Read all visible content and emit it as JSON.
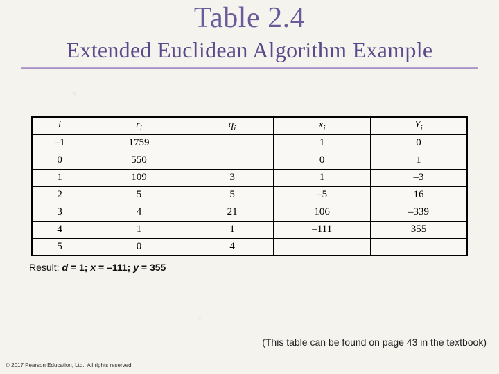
{
  "title": "Table 2.4",
  "subtitle": "Extended Euclidean Algorithm Example",
  "chart_data": {
    "type": "table",
    "headers": [
      {
        "sym": "i",
        "sub": ""
      },
      {
        "sym": "r",
        "sub": "i"
      },
      {
        "sym": "q",
        "sub": "i"
      },
      {
        "sym": "x",
        "sub": "i"
      },
      {
        "sym": "Y",
        "sub": "i"
      }
    ],
    "rows": [
      {
        "i": "–1",
        "r": "1759",
        "q": "",
        "x": "1",
        "y": "0"
      },
      {
        "i": "0",
        "r": "550",
        "q": "",
        "x": "0",
        "y": "1"
      },
      {
        "i": "1",
        "r": "109",
        "q": "3",
        "x": "1",
        "y": "–3"
      },
      {
        "i": "2",
        "r": "5",
        "q": "5",
        "x": "–5",
        "y": "16"
      },
      {
        "i": "3",
        "r": "4",
        "q": "21",
        "x": "106",
        "y": "–339"
      },
      {
        "i": "4",
        "r": "1",
        "q": "1",
        "x": "–111",
        "y": "355"
      },
      {
        "i": "5",
        "r": "0",
        "q": "4",
        "x": "",
        "y": ""
      }
    ]
  },
  "result": {
    "prefix": "Result: ",
    "d_var": "d",
    "d_val": " = 1; ",
    "x_var": "x",
    "x_val": " = –111; ",
    "y_var": "y",
    "y_val": " = 355"
  },
  "caption": "(This table can be found on page 43 in the textbook)",
  "copyright": "© 2017 Pearson Education, Ltd., All rights reserved."
}
